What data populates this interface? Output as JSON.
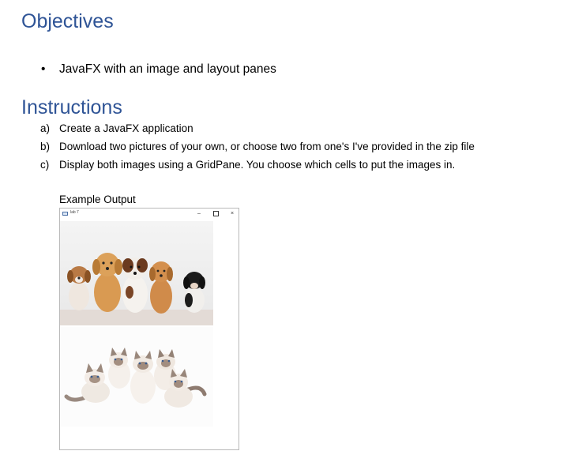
{
  "objectives": {
    "heading": "Objectives",
    "bullet_glyph": "•",
    "items": [
      "JavaFX with an image and layout panes"
    ]
  },
  "instructions": {
    "heading": "Instructions",
    "steps": [
      {
        "letter": "a)",
        "text": "Create a JavaFX application"
      },
      {
        "letter": "b)",
        "text": "Download two pictures of your own, or choose two from one's I've provided in the zip file"
      },
      {
        "letter": "c)",
        "text": "Display both images using a GridPane. You choose which cells to put the images in."
      }
    ]
  },
  "example": {
    "caption": "Example Output",
    "window": {
      "title": "lab 7",
      "minimize_glyph": "–",
      "close_glyph": "×",
      "images": [
        {
          "name": "puppies-photo",
          "icon": "photo-puppies"
        },
        {
          "name": "kittens-photo",
          "icon": "photo-kittens"
        }
      ]
    }
  }
}
